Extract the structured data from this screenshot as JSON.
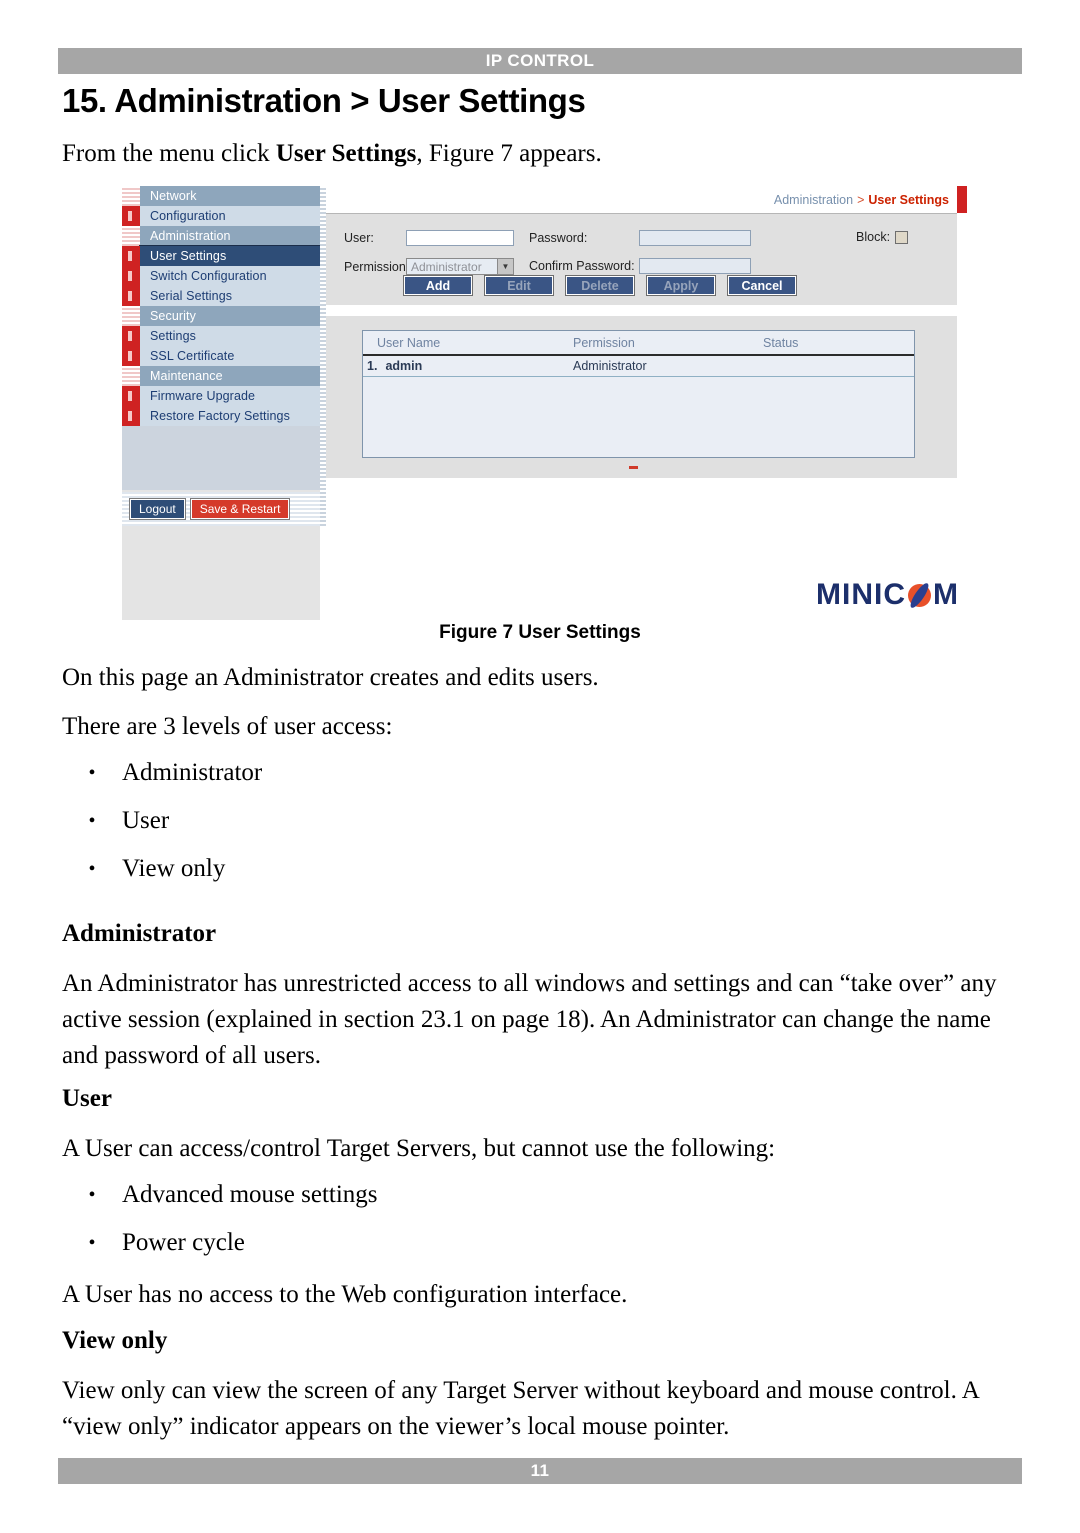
{
  "header": {
    "running_head": "IP CONTROL"
  },
  "footer": {
    "page_number": "11"
  },
  "section": {
    "title": "15. Administration > User Settings",
    "intro_prefix": "From the menu click ",
    "intro_bold": "User Settings",
    "intro_suffix": ", Figure 7 appears."
  },
  "figure": {
    "caption": "Figure 7 User Settings",
    "logo_pre": "MINIC",
    "logo_post": "M",
    "breadcrumb": {
      "parent": "Administration",
      "separator": ">",
      "current": "User Settings"
    },
    "nav": {
      "items": [
        {
          "label": "Network",
          "type": "group",
          "marker": "hatch"
        },
        {
          "label": "Configuration",
          "type": "item",
          "marker": "solid"
        },
        {
          "label": "Administration",
          "type": "group",
          "marker": "hatch"
        },
        {
          "label": "User Settings",
          "type": "item",
          "marker": "solid",
          "selected": true
        },
        {
          "label": "Switch Configuration",
          "type": "item",
          "marker": "solid"
        },
        {
          "label": "Serial Settings",
          "type": "item",
          "marker": "solid"
        },
        {
          "label": "Security",
          "type": "group",
          "marker": "hatch"
        },
        {
          "label": "Settings",
          "type": "item",
          "marker": "solid"
        },
        {
          "label": "SSL Certificate",
          "type": "item",
          "marker": "solid"
        },
        {
          "label": "Maintenance",
          "type": "group",
          "marker": "hatch"
        },
        {
          "label": "Firmware Upgrade",
          "type": "item",
          "marker": "solid"
        },
        {
          "label": "Restore Factory Settings",
          "type": "item",
          "marker": "solid"
        }
      ],
      "logout_label": "Logout",
      "save_restart_label": "Save & Restart"
    },
    "form": {
      "user_label": "User:",
      "user_value": "",
      "permission_label": "Permission:",
      "permission_value": "Administrator",
      "password_label": "Password:",
      "password_value": "",
      "confirm_label": "Confirm Password:",
      "confirm_value": "",
      "block_label": "Block:",
      "block_checked": false,
      "buttons": [
        {
          "label": "Add",
          "enabled": true
        },
        {
          "label": "Edit",
          "enabled": false
        },
        {
          "label": "Delete",
          "enabled": false
        },
        {
          "label": "Apply",
          "enabled": false
        },
        {
          "label": "Cancel",
          "enabled": true
        }
      ]
    },
    "table": {
      "columns": [
        "User Name",
        "Permission",
        "Status"
      ],
      "rows": [
        {
          "index": "1.",
          "user_name": "admin",
          "permission": "Administrator",
          "status": ""
        }
      ]
    }
  },
  "body": {
    "p_intro": "On this page an Administrator creates and edits users.",
    "p_levels": "There are 3 levels of user access:",
    "levels": [
      "Administrator",
      "User",
      "View only"
    ],
    "admin_head": "Administrator",
    "admin_text": "An Administrator has unrestricted access to all windows and settings and can “take over” any active session (explained in section 23.1 on page 18). An Administrator can change the name and password of all users.",
    "user_head": "User",
    "user_text": "A User can access/control Target Servers, but cannot use the following:",
    "user_restrictions": [
      "Advanced mouse settings",
      "Power cycle"
    ],
    "user_note": "A User has no access to the Web configuration interface.",
    "view_head": "View only",
    "view_text": "View only can view the screen of any Target Server without keyboard and mouse control. A “view only” indicator appears on the viewer’s local mouse pointer."
  }
}
